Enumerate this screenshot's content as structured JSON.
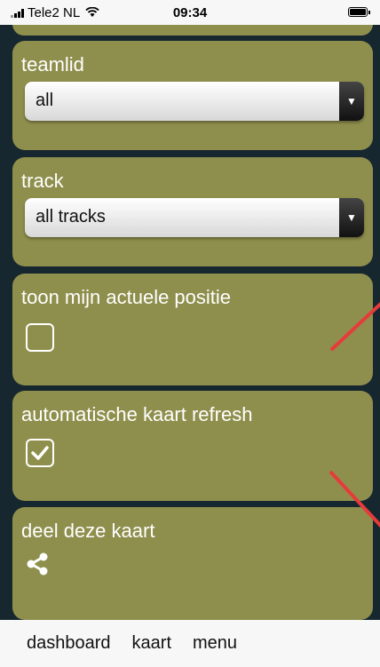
{
  "status_bar": {
    "carrier": "Tele2 NL",
    "time": "09:34",
    "signal_icon": "signal-icon",
    "wifi_icon": "wifi-icon",
    "battery_icon": "battery-icon"
  },
  "panels": {
    "teamlid": {
      "label": "teamlid",
      "selected": "all"
    },
    "track": {
      "label": "track",
      "selected": "all tracks"
    },
    "position": {
      "label": "toon mijn actuele positie",
      "checked": false
    },
    "refresh": {
      "label": "automatische kaart refresh",
      "checked": true
    },
    "share": {
      "label": "deel deze kaart",
      "icon": "share-icon"
    }
  },
  "tabbar": {
    "dashboard": "dashboard",
    "kaart": "kaart",
    "menu": "menu"
  },
  "colors": {
    "panel": "#8f8f4d",
    "background": "#17272f",
    "annotation": "#e63b3b"
  }
}
